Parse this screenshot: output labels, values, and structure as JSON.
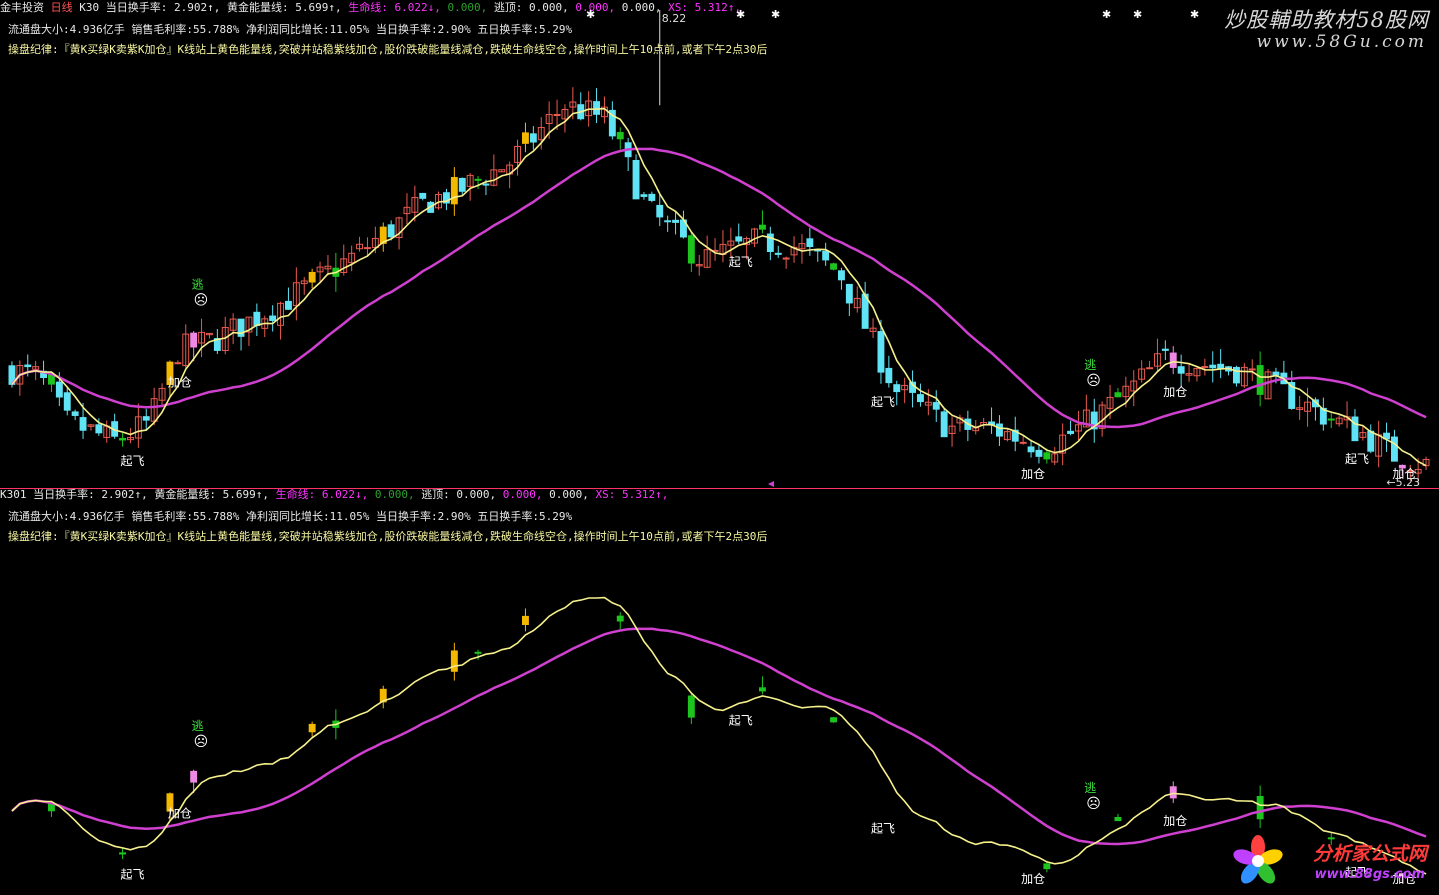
{
  "top": {
    "status_segments": [
      {
        "t": "金丰投资",
        "c": "w"
      },
      {
        "t": " 日线",
        "c": "red"
      },
      {
        "t": " K30 ",
        "c": "w"
      },
      {
        "t": "当日换手率: 2.902↑, ",
        "c": "w"
      },
      {
        "t": "黄金能量线: 5.699↑, ",
        "c": "w"
      },
      {
        "t": "生命线: 6.022↓, ",
        "c": "m"
      },
      {
        "t": "0.000, ",
        "c": "g"
      },
      {
        "t": "逃顶: 0.000, ",
        "c": "w"
      },
      {
        "t": "0.000, ",
        "c": "m"
      },
      {
        "t": "0.000, ",
        "c": "w"
      },
      {
        "t": "XS: 5.312↑,",
        "c": "m"
      }
    ],
    "info_line": [
      {
        "t": "流通盘大小:4.936亿手",
        "c": "w"
      },
      {
        "t": "  销售毛利率:55.788%",
        "c": "w"
      },
      {
        "t": "  净利润同比增长:11.05%",
        "c": "w"
      },
      {
        "t": "     当日换手率:2.90%",
        "c": "w"
      },
      {
        "t": "   五日换手率:5.29%",
        "c": "w"
      }
    ],
    "rule_line": "操盘纪律:『黄K买绿K卖紫K加仓』K线站上黄色能量线,突破并站稳紫线加仓,股价跌破能量线减仓,跌破生命线空仓,操作时间上午10点前,或者下午2点30后",
    "max_label": "8.22",
    "min_label": "←5.23"
  },
  "bottom": {
    "status_segments": [
      {
        "t": "K301 ",
        "c": "w"
      },
      {
        "t": "当日换手率: 2.902↑, ",
        "c": "w"
      },
      {
        "t": "黄金能量线: 5.699↑, ",
        "c": "w"
      },
      {
        "t": "生命线: 6.022↓, ",
        "c": "m"
      },
      {
        "t": "0.000, ",
        "c": "g"
      },
      {
        "t": "逃顶: 0.000, ",
        "c": "w"
      },
      {
        "t": "0.000, ",
        "c": "m"
      },
      {
        "t": "0.000, ",
        "c": "w"
      },
      {
        "t": "XS: 5.312↑,",
        "c": "m"
      }
    ],
    "info_line": [
      {
        "t": "流通盘大小:4.936亿手",
        "c": "w"
      },
      {
        "t": "  销售毛利率:55.788%",
        "c": "w"
      },
      {
        "t": "  净利润同比增长:11.05%",
        "c": "w"
      },
      {
        "t": "     当日换手率:2.90%",
        "c": "w"
      },
      {
        "t": "   五日换手率:5.29%",
        "c": "w"
      }
    ],
    "rule_line": "操盘纪律:『黄K买绿K卖紫K加仓』K线站上黄色能量线,突破并站稳紫线加仓,股价跌破能量线减仓,跌破生命线空仓,操作时间上午10点前,或者下午2点30后"
  },
  "signals": {
    "takeoff": "起飞",
    "add": "加仓",
    "escape": "逃",
    "face": "☹"
  },
  "watermark_top": {
    "title": "炒股輔助教材58股网",
    "url": "www.58Gu.com"
  },
  "watermark_bottom": {
    "title": "分析家公式网",
    "url": "www.88gs.com"
  },
  "colors": {
    "background": "#000000",
    "energy_line": "#f5f08c",
    "life_line": "#d040d0",
    "up_candle": "#e85a4f",
    "down_candle": "#5fe3f5",
    "buy_yellow": "#f5b800",
    "sell_green": "#1ec41e",
    "add_pink": "#f088e6",
    "divider": "#ff3366"
  },
  "chart_data": {
    "type": "candlestick",
    "price_high": 8.22,
    "price_low": 5.23,
    "top_annotations": [
      {
        "label": "起飞",
        "x_index": 15
      },
      {
        "label": "加仓",
        "x_index": 21
      },
      {
        "label": "逃",
        "x_index": 24
      },
      {
        "label": "起飞",
        "x_index": 92
      },
      {
        "label": "起飞",
        "x_index": 110
      },
      {
        "label": "加仓",
        "x_index": 129
      },
      {
        "label": "逃",
        "x_index": 137
      },
      {
        "label": "加仓",
        "x_index": 147
      },
      {
        "label": "起飞",
        "x_index": 170
      },
      {
        "label": "加仓",
        "x_index": 176
      }
    ]
  }
}
